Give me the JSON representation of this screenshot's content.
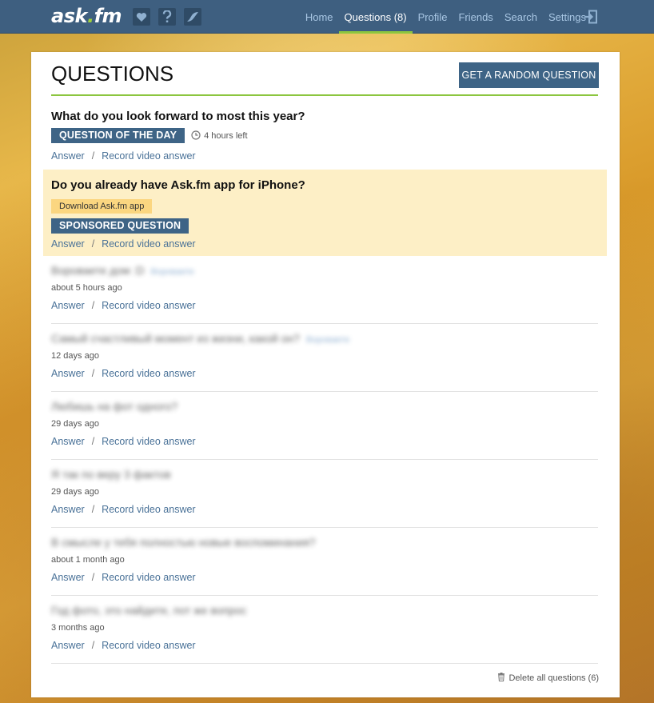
{
  "brand": {
    "logo_main": "ask",
    "logo_dot": ".",
    "logo_tld": "fm"
  },
  "nav": {
    "items": [
      {
        "label": "Home"
      },
      {
        "label": "Questions (8)"
      },
      {
        "label": "Profile"
      },
      {
        "label": "Friends"
      },
      {
        "label": "Search"
      },
      {
        "label": "Settings"
      }
    ],
    "active": "Questions (8)"
  },
  "header": {
    "title": "QUESTIONS",
    "random_button": "GET A RANDOM QUESTION"
  },
  "qotd": {
    "text": "What do you look forward to most this year?",
    "tag": "QUESTION OF THE DAY",
    "time_left": "4 hours left"
  },
  "sponsored": {
    "text": "Do you already have Ask.fm app for iPhone?",
    "download_label": "Download Ask.fm app",
    "tag": "SPONSORED QUESTION"
  },
  "actions": {
    "answer": "Answer",
    "separator": "/",
    "video": "Record video answer"
  },
  "questions": [
    {
      "text": "Вороваете дом :D",
      "link": "Вороваете",
      "time": "about 5 hours ago"
    },
    {
      "text": "Самый счастливый момент из жизни, какой он?",
      "link": "Вороваете",
      "time": "12 days ago"
    },
    {
      "text": "Любишь на фот одного?",
      "link": "",
      "time": "29 days ago"
    },
    {
      "text": "Я так по веру 3 фактов",
      "link": "",
      "time": "29 days ago"
    },
    {
      "text": "В смысле у тебя полностью новые воспоминания?",
      "link": "",
      "time": "about 1 month ago"
    },
    {
      "text": "Год фото, это найдите, пот же вопрос",
      "link": "",
      "time": "3 months ago"
    }
  ],
  "footer": {
    "delete_all": "Delete all questions (6)"
  },
  "colors": {
    "topbar": "#3e5f80",
    "accent_green": "#8cc63f",
    "tag_blue": "#3e6486",
    "sponsored_bg": "#fdefc6"
  }
}
